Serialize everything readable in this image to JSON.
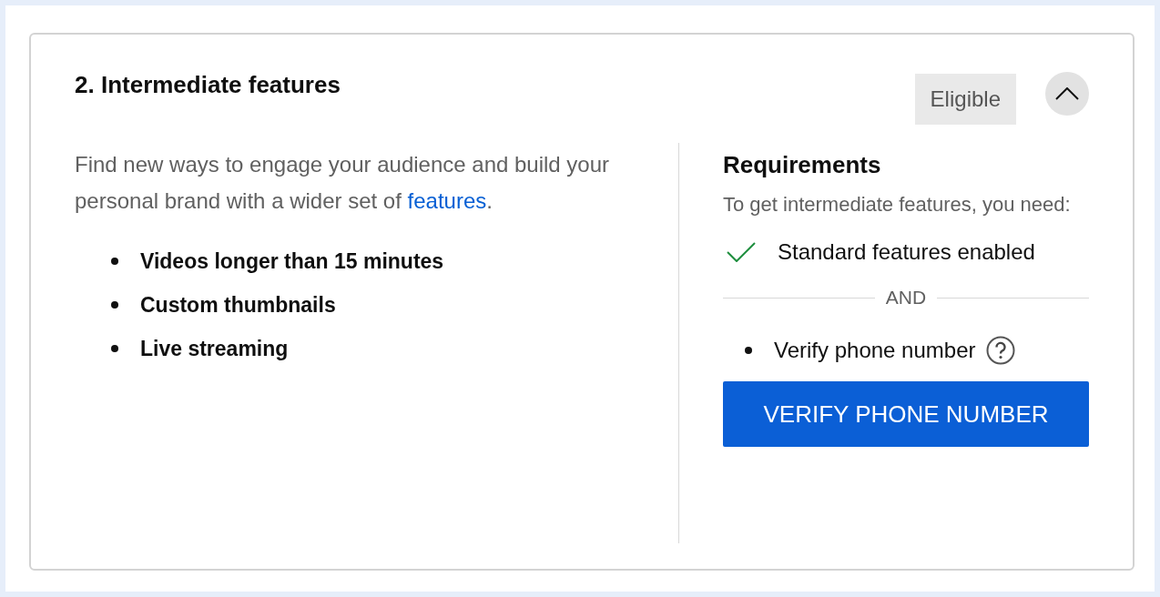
{
  "section": {
    "title": "2. Intermediate features",
    "status_badge": "Eligible",
    "expanded": true
  },
  "description": {
    "text_before": "Find new ways to engage your audience and build your personal brand with a wider set of ",
    "link": "features",
    "text_after": "."
  },
  "features": [
    "Videos longer than 15 minutes",
    "Custom thumbnails",
    "Live streaming"
  ],
  "requirements": {
    "title": "Requirements",
    "intro": "To get intermediate features, you need:",
    "items": [
      {
        "kind": "met",
        "label": "Standard features enabled"
      },
      {
        "kind": "separator",
        "label": "AND"
      },
      {
        "kind": "pending",
        "label": "Verify phone number"
      }
    ]
  },
  "action_button": "VERIFY PHONE NUMBER"
}
